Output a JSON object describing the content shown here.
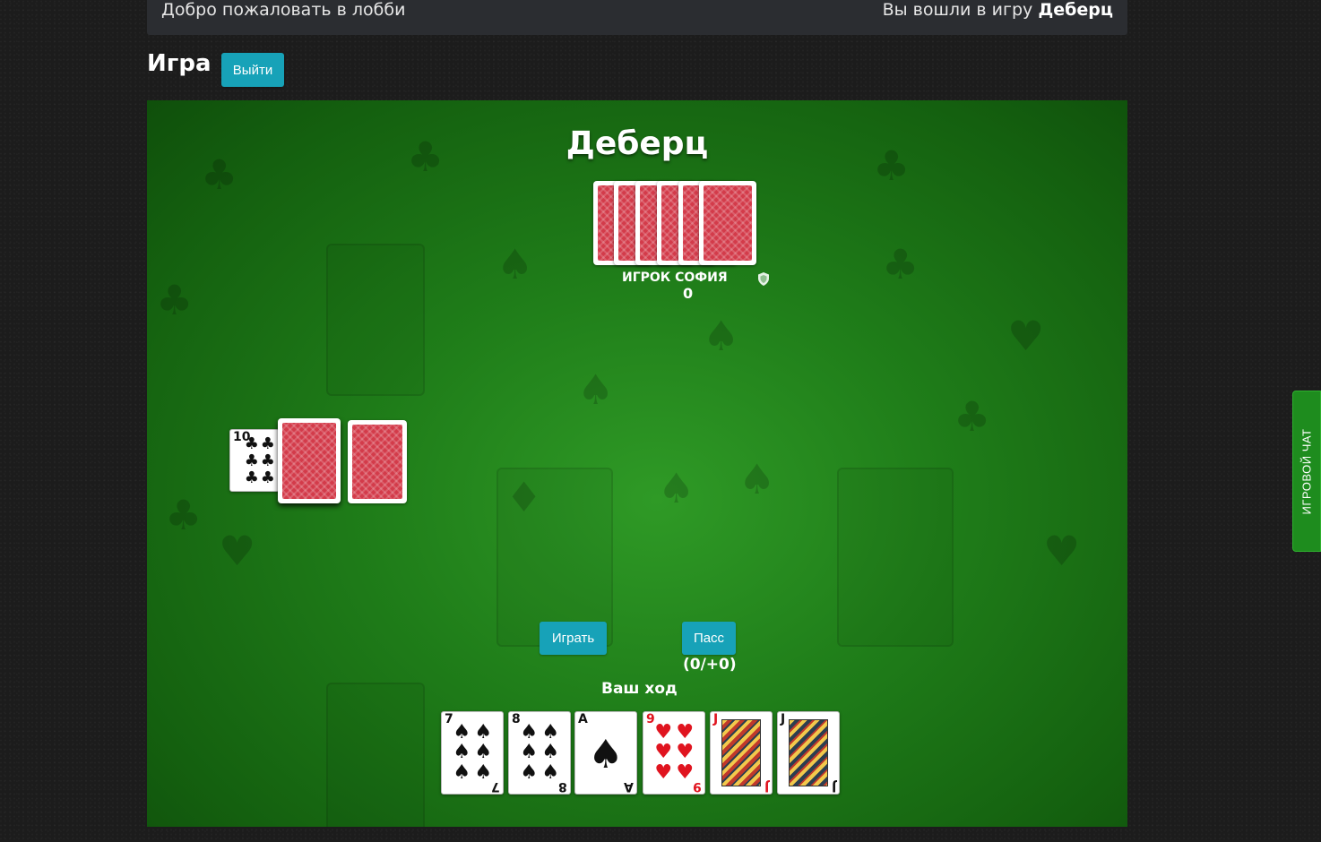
{
  "topbar": {
    "welcome": "Добро пожаловать в лобби",
    "entered_prefix": "Вы вошли в игру ",
    "entered_game": "Деберц"
  },
  "page": {
    "heading": "Игра",
    "exit_label": "Выйти"
  },
  "table": {
    "title": "Деберц",
    "opponent": {
      "name": "ИГРОК СОФИЯ",
      "score": "0",
      "icon": "shield-icon",
      "cards_in_hand": 6
    },
    "trick": [
      {
        "rank": "10",
        "suit": "♣",
        "face": "up"
      },
      {
        "face": "down"
      },
      {
        "face": "down"
      }
    ],
    "actions": {
      "play_label": "Играть",
      "pass_label": "Пасс",
      "pass_count": "(0/+0)"
    },
    "turn_text": "Ваш ход",
    "hand": [
      {
        "rank": "7",
        "suit": "♠"
      },
      {
        "rank": "8",
        "suit": "♠"
      },
      {
        "rank": "A",
        "suit": "♠"
      },
      {
        "rank": "9",
        "suit": "♥"
      },
      {
        "rank": "J",
        "suit": "♥"
      },
      {
        "rank": "J",
        "suit": "♣"
      }
    ]
  },
  "chat": {
    "label": "ИГРОВОЙ ЧАТ"
  },
  "colors": {
    "felt": "#1f7d19",
    "button": "#17a2b8",
    "chat_tab": "#1e8c1e",
    "card_back": "#d33b4a"
  }
}
